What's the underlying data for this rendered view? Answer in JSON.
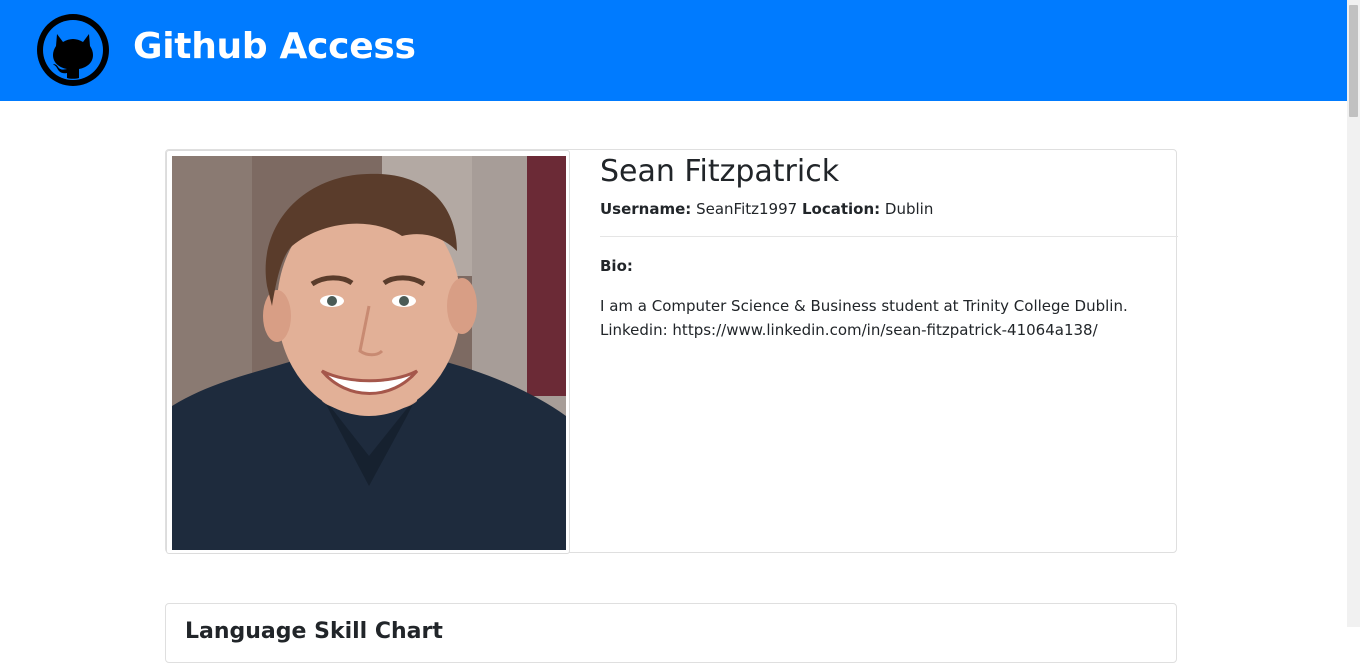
{
  "navbar": {
    "logo_icon": "github-octocat-icon",
    "title": "Github Access",
    "background_color": "#007bff"
  },
  "profile": {
    "avatar_alt": "profile-photo",
    "name": "Sean Fitzpatrick",
    "username_label": "Username:",
    "username": "SeanFitz1997",
    "location_label": "Location:",
    "location": "Dublin",
    "bio_label": "Bio:",
    "bio": "I am a Computer Science & Business student at Trinity College Dublin. Linkedin: https://www.linkedin.com/in/sean-fitzpatrick-41064a138/"
  },
  "skills": {
    "title": "Language Skill Chart"
  }
}
